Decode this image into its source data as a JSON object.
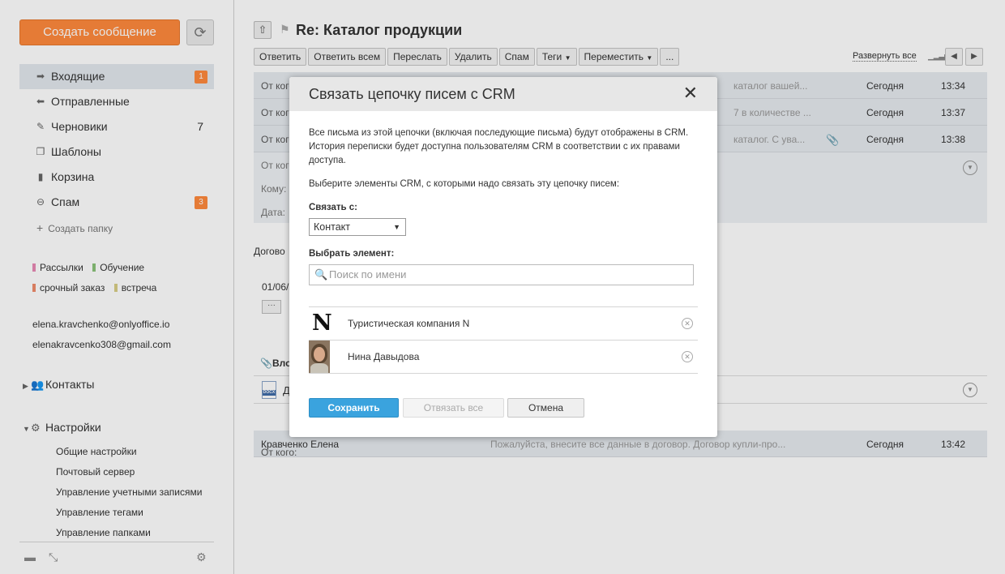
{
  "sidebar": {
    "create_button": "Создать сообщение",
    "refresh_icon": "refresh-icon",
    "folders": [
      {
        "label": "Входящие",
        "icon": "inbox-icon",
        "count": "1",
        "badge": true,
        "active": true
      },
      {
        "label": "Отправленные",
        "icon": "sent-icon",
        "count": "",
        "badge": false,
        "active": false
      },
      {
        "label": "Черновики",
        "icon": "drafts-icon",
        "count": "7",
        "badge": false,
        "active": false
      },
      {
        "label": "Шаблоны",
        "icon": "templates-icon",
        "count": "",
        "badge": false,
        "active": false
      },
      {
        "label": "Корзина",
        "icon": "trash-icon",
        "count": "",
        "badge": false,
        "active": false
      },
      {
        "label": "Спам",
        "icon": "spam-icon",
        "count": "3",
        "badge": true,
        "active": false
      }
    ],
    "create_folder": "Создать папку",
    "tags": [
      {
        "label": "Рассылки",
        "color": "#e88ab5"
      },
      {
        "label": "Обучение",
        "color": "#8bc37a"
      },
      {
        "label": "срочный заказ",
        "color": "#f08c6b"
      },
      {
        "label": "встреча",
        "color": "#d9cf86"
      }
    ],
    "accounts": [
      "elena.kravchenko@onlyoffice.io",
      "elenakravcenko308@gmail.com"
    ],
    "contacts_label": "Контакты",
    "settings_label": "Настройки",
    "settings_items": [
      "Общие настройки",
      "Почтовый сервер",
      "Управление учетными записями",
      "Управление тегами",
      "Управление папками"
    ]
  },
  "main": {
    "subject": "Re: Каталог продукции",
    "toolbar": [
      "Ответить",
      "Ответить всем",
      "Переслать",
      "Удалить",
      "Спам",
      "Теги",
      "Переместить",
      "..."
    ],
    "expand_all": "Развернуть все",
    "messages": [
      {
        "from": "От кого:",
        "snippet": "каталог вашей...",
        "date": "Сегодня",
        "time": "13:34"
      },
      {
        "from": "От кого:",
        "snippet": "7 в количестве ...",
        "date": "Сегодня",
        "time": "13:37"
      },
      {
        "from": "От кого:",
        "snippet": "каталог. С ува...",
        "date": "Сегодня",
        "time": "13:38"
      }
    ],
    "details": {
      "from": "От кого:",
      "to": "Кому:",
      "date": "Дата:"
    },
    "body_text": "Догово",
    "body_date": "01/06/",
    "more": "···",
    "attachments_label": "Вло",
    "attachment_name": "Д",
    "last_message": {
      "from_label": "От кого:",
      "from_name": "Кравченко Елена",
      "snippet": "Пожалуйста, внесите все данные в договор. Договор купли-про...",
      "date": "Сегодня",
      "time": "13:42"
    }
  },
  "modal": {
    "title": "Связать цепочку писем с CRM",
    "description": "Все письма из этой цепочки (включая последующие письма) будут отображены в CRM. История переписки будет доступна пользователям CRM в соответствии с их правами доступа.",
    "prompt": "Выберите элементы CRM, с которыми надо связать эту цепочку писем:",
    "link_with_label": "Связать с:",
    "link_with_value": "Контакт",
    "select_label": "Выбрать элемент:",
    "search_placeholder": "Поиск по имени",
    "items": [
      {
        "name": "Туристическая компания N",
        "logo": "N"
      },
      {
        "name": "Нина Давыдова"
      }
    ],
    "save": "Сохранить",
    "unlink_all": "Отвязать все",
    "cancel": "Отмена"
  }
}
